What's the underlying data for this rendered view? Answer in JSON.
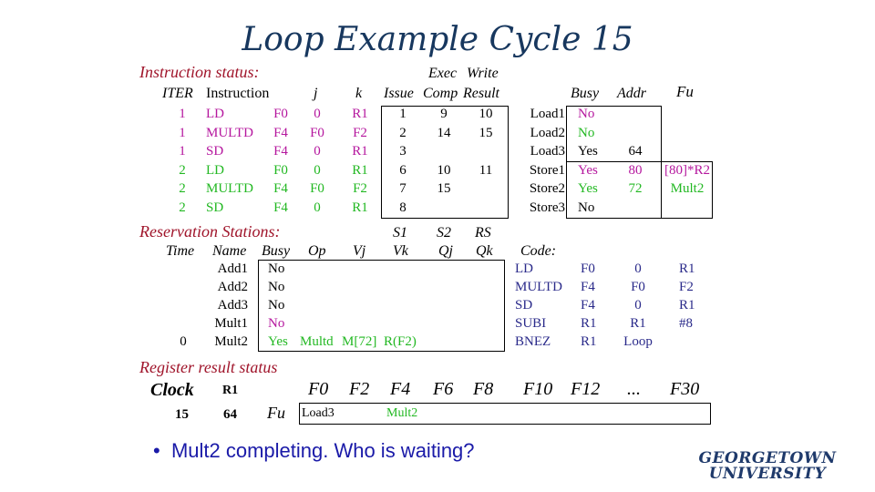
{
  "title": "Loop Example Cycle 15",
  "instruction_status": {
    "section_label": "Instruction status:",
    "group_headers": {
      "exec": "Exec",
      "write": "Write"
    },
    "columns": [
      "ITER",
      "Instruction",
      "j",
      "k",
      "Issue",
      "Comp",
      "Result"
    ],
    "rows": [
      {
        "iter": "1",
        "op": "LD",
        "dest": "F0",
        "j": "0",
        "k": "R1",
        "issue": "1",
        "comp": "9",
        "result": "10",
        "color": "magenta"
      },
      {
        "iter": "1",
        "op": "MULTD",
        "dest": "F4",
        "j": "F0",
        "k": "F2",
        "issue": "2",
        "comp": "14",
        "result": "15",
        "color": "magenta"
      },
      {
        "iter": "1",
        "op": "SD",
        "dest": "F4",
        "j": "0",
        "k": "R1",
        "issue": "3",
        "comp": "",
        "result": "",
        "color": "magenta"
      },
      {
        "iter": "2",
        "op": "LD",
        "dest": "F0",
        "j": "0",
        "k": "R1",
        "issue": "6",
        "comp": "10",
        "result": "11",
        "color": "green"
      },
      {
        "iter": "2",
        "op": "MULTD",
        "dest": "F4",
        "j": "F0",
        "k": "F2",
        "issue": "7",
        "comp": "15",
        "result": "",
        "color": "green"
      },
      {
        "iter": "2",
        "op": "SD",
        "dest": "F4",
        "j": "0",
        "k": "R1",
        "issue": "8",
        "comp": "",
        "result": "",
        "color": "green"
      }
    ]
  },
  "load_store_buffers": {
    "columns": [
      "Busy",
      "Addr",
      "Fu"
    ],
    "rows": [
      {
        "name": "Load1",
        "busy": "No",
        "addr": "",
        "fu": "",
        "color": "magenta"
      },
      {
        "name": "Load2",
        "busy": "No",
        "addr": "",
        "fu": "",
        "color": "green"
      },
      {
        "name": "Load3",
        "busy": "Yes",
        "addr": "64",
        "fu": "",
        "color": "black"
      },
      {
        "name": "Store1",
        "busy": "Yes",
        "addr": "80",
        "fu": "[80]*R2",
        "color": "magenta"
      },
      {
        "name": "Store2",
        "busy": "Yes",
        "addr": "72",
        "fu": "Mult2",
        "color": "green"
      },
      {
        "name": "Store3",
        "busy": "No",
        "addr": "",
        "fu": "",
        "color": "black"
      }
    ]
  },
  "reservation_stations": {
    "section_label": "Reservation Stations:",
    "group_headers": {
      "s1": "S1",
      "s2": "S2",
      "rs": "RS"
    },
    "columns": [
      "Time",
      "Name",
      "Busy",
      "Op",
      "Vj",
      "Vk",
      "Qj",
      "Qk"
    ],
    "rows": [
      {
        "time": "",
        "name": "Add1",
        "busy": "No",
        "op": "",
        "vj": "",
        "vk": "",
        "qj": "",
        "qk": "",
        "color": "black"
      },
      {
        "time": "",
        "name": "Add2",
        "busy": "No",
        "op": "",
        "vj": "",
        "vk": "",
        "qj": "",
        "qk": "",
        "color": "black"
      },
      {
        "time": "",
        "name": "Add3",
        "busy": "No",
        "op": "",
        "vj": "",
        "vk": "",
        "qj": "",
        "qk": "",
        "color": "black"
      },
      {
        "time": "",
        "name": "Mult1",
        "busy": "No",
        "op": "",
        "vj": "",
        "vk": "",
        "qj": "",
        "qk": "",
        "color": "magenta"
      },
      {
        "time": "0",
        "name": "Mult2",
        "busy": "Yes",
        "op": "Multd",
        "vj": "M[72]",
        "vk": "R(F2)",
        "qj": "",
        "qk": "",
        "color": "green"
      }
    ]
  },
  "code": {
    "label": "Code:",
    "lines": [
      [
        "LD",
        "F0",
        "0",
        "R1"
      ],
      [
        "MULTD",
        "F4",
        "F0",
        "F2"
      ],
      [
        "SD",
        "F4",
        "0",
        "R1"
      ],
      [
        "SUBI",
        "R1",
        "R1",
        "#8"
      ],
      [
        "BNEZ",
        "R1",
        "Loop",
        ""
      ]
    ]
  },
  "register_result_status": {
    "section_label": "Register result status",
    "clock_label": "Clock",
    "clock_value": "15",
    "r1_label": "R1",
    "r1_value": "64",
    "fu_label": "Fu",
    "registers": [
      "F0",
      "F2",
      "F4",
      "F6",
      "F8",
      "F10",
      "F12",
      "...",
      "F30"
    ],
    "fu_values": [
      "Load3",
      "",
      "Mult2",
      "",
      "",
      "",
      "",
      "",
      ""
    ]
  },
  "bullet": "Mult2 completing.  Who is waiting?",
  "logo": {
    "line1": "GEORGETOWN",
    "line2": "UNIVERSITY"
  },
  "colors": {
    "magenta": "#b5179e",
    "green": "#22b822",
    "title": "#17375e",
    "section": "#a0152b",
    "code": "#2a2a8a",
    "bullet": "#1a1aa8"
  }
}
